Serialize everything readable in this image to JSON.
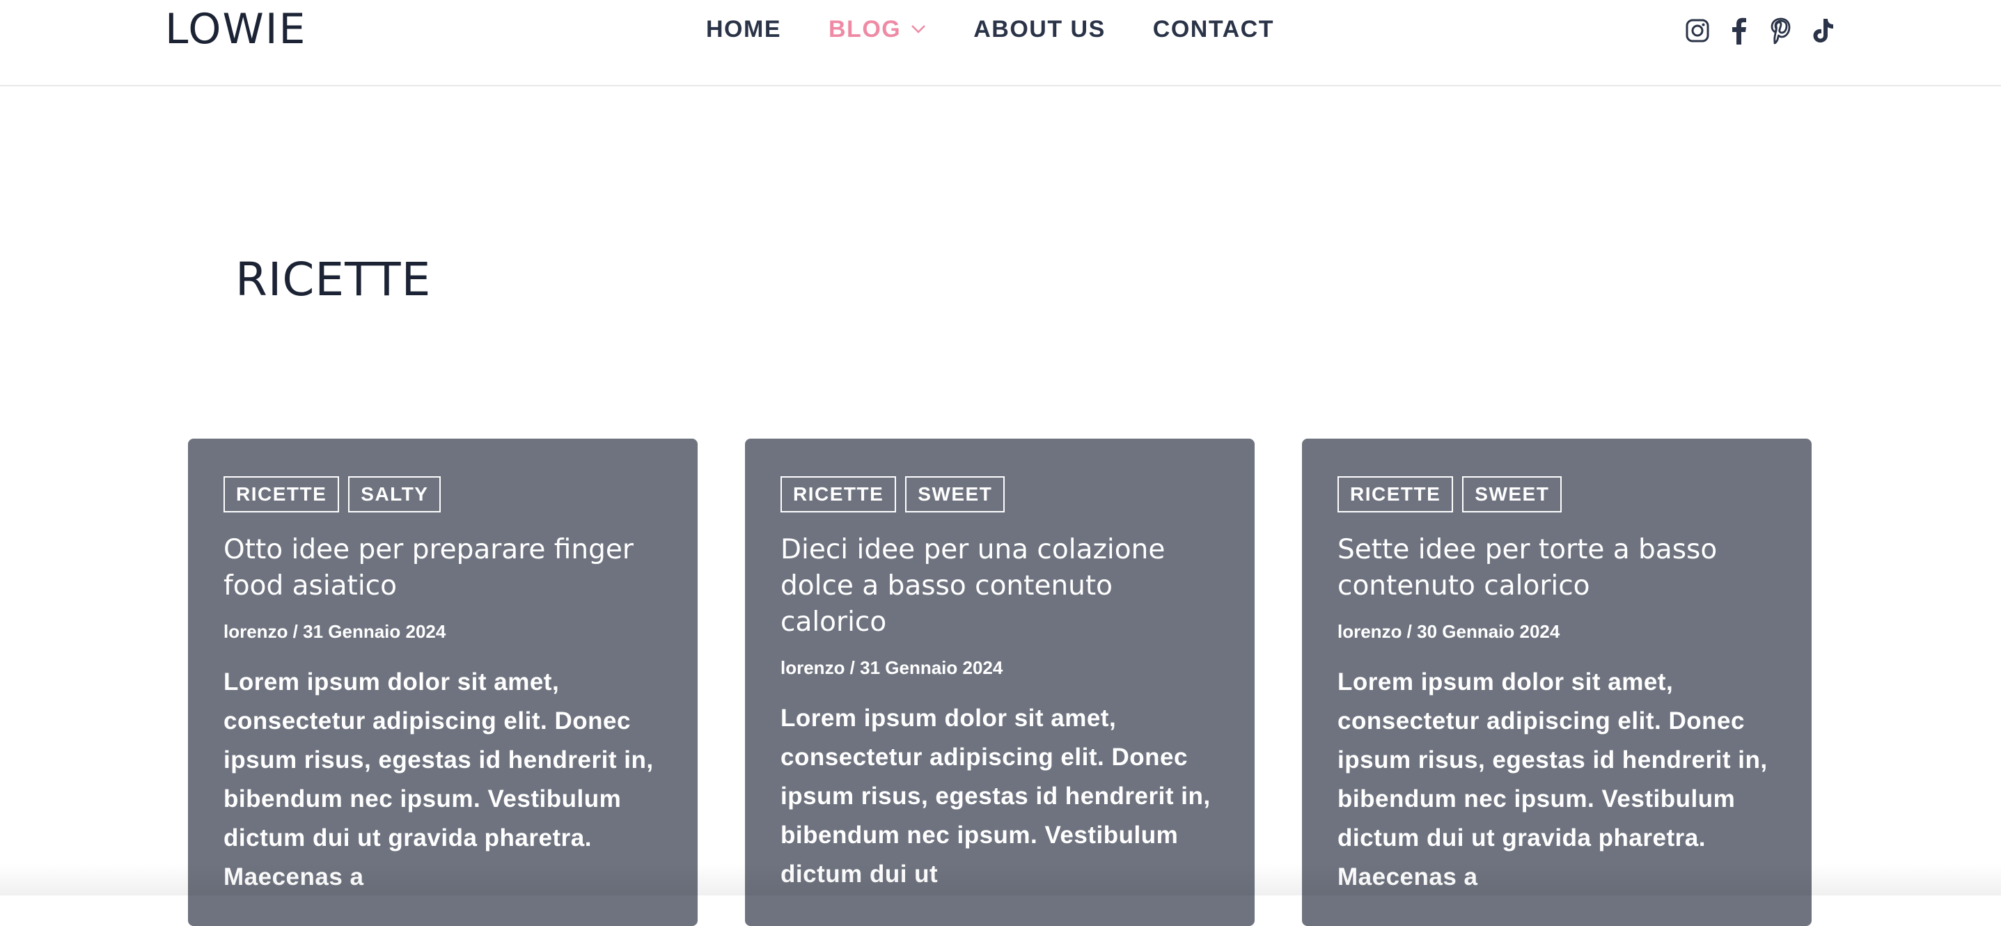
{
  "brand": {
    "logo_text": "LOWIE"
  },
  "nav": {
    "items": [
      {
        "label": "HOME",
        "active": false
      },
      {
        "label": "BLOG",
        "active": true,
        "has_dropdown": true
      },
      {
        "label": "ABOUT US",
        "active": false
      },
      {
        "label": "CONTACT",
        "active": false
      }
    ]
  },
  "social": {
    "icons": [
      "instagram-icon",
      "facebook-icon",
      "pinterest-icon",
      "tiktok-icon"
    ]
  },
  "colors": {
    "accent": "#ef8aa5",
    "nav_text": "#2a3347",
    "card_bg": "#6e737f",
    "heading": "#1b2334"
  },
  "page": {
    "title": "RICETTE"
  },
  "posts": [
    {
      "tags": [
        "RICETTE",
        "SALTY"
      ],
      "title": "Otto idee per preparare finger food asiatico",
      "meta": "lorenzo / 31 Gennaio 2024",
      "excerpt": "Lorem ipsum dolor sit amet, consectetur adipiscing elit. Donec ipsum risus, egestas id hendrerit in, bibendum nec ipsum. Vestibulum dictum dui ut gravida pharetra. Maecenas a"
    },
    {
      "tags": [
        "RICETTE",
        "SWEET"
      ],
      "title": "Dieci idee per una colazione dolce a basso contenuto calorico",
      "meta": "lorenzo / 31 Gennaio 2024",
      "excerpt": "Lorem ipsum dolor sit amet, consectetur adipiscing elit. Donec ipsum risus, egestas id hendrerit in, bibendum nec ipsum. Vestibulum dictum dui ut"
    },
    {
      "tags": [
        "RICETTE",
        "SWEET"
      ],
      "title": "Sette idee per torte a basso contenuto calorico",
      "meta": "lorenzo / 30 Gennaio 2024",
      "excerpt": "Lorem ipsum dolor sit amet, consectetur adipiscing elit. Donec ipsum risus, egestas id hendrerit in, bibendum nec ipsum. Vestibulum dictum dui ut gravida pharetra. Maecenas a"
    }
  ]
}
